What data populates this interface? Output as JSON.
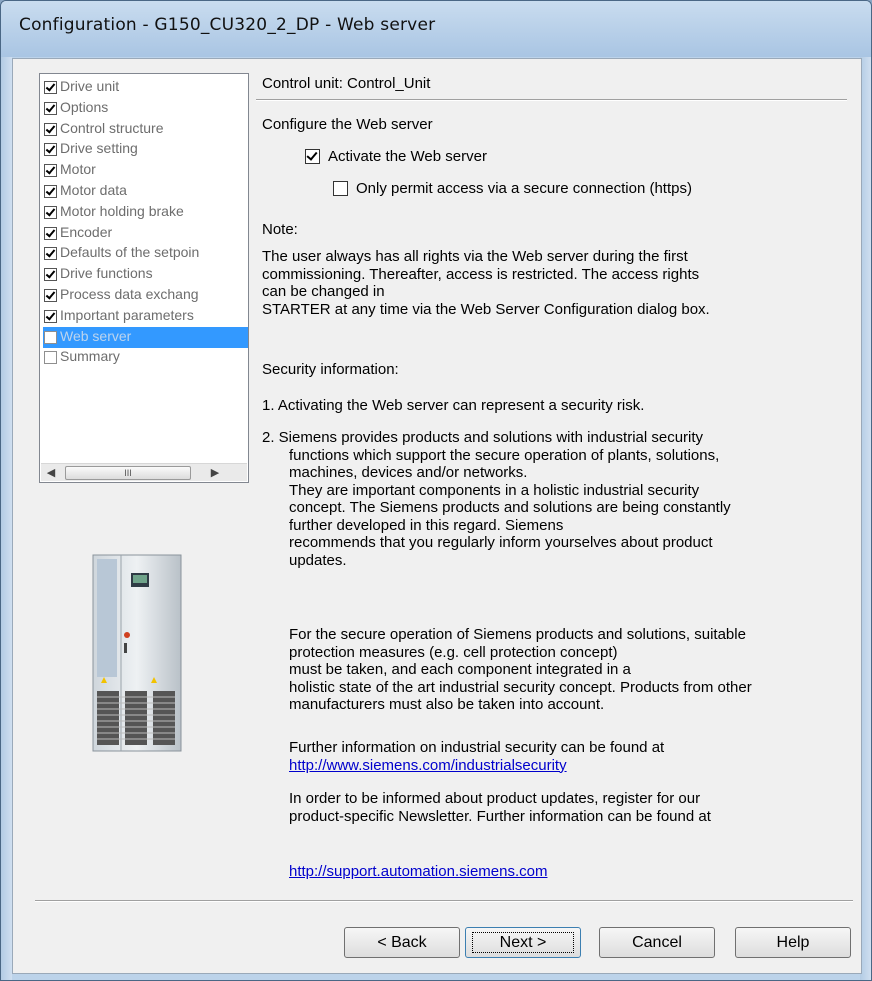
{
  "window": {
    "title": "Configuration - G150_CU320_2_DP - Web server"
  },
  "tree": {
    "items": [
      {
        "label": "Drive unit",
        "checked": true
      },
      {
        "label": "Options",
        "checked": true
      },
      {
        "label": "Control structure",
        "checked": true
      },
      {
        "label": "Drive setting",
        "checked": true
      },
      {
        "label": "Motor",
        "checked": true
      },
      {
        "label": "Motor data",
        "checked": true
      },
      {
        "label": "Motor holding brake",
        "checked": true
      },
      {
        "label": "Encoder",
        "checked": true
      },
      {
        "label": "Defaults of the setpoin",
        "checked": true
      },
      {
        "label": "Drive functions",
        "checked": true
      },
      {
        "label": "Process data exchang",
        "checked": true
      },
      {
        "label": "Important parameters",
        "checked": true
      },
      {
        "label": "Web server",
        "checked": false,
        "selected": true
      },
      {
        "label": "Summary",
        "checked": false
      }
    ],
    "scroll_thumb": "III"
  },
  "header": {
    "control_unit": "Control unit: Control_Unit"
  },
  "config": {
    "heading": "Configure the Web server",
    "activate_label": "Activate the Web server",
    "activate_checked": true,
    "https_label": "Only permit access via a secure connection (https)",
    "https_checked": false
  },
  "note": {
    "heading": "Note:",
    "line1": "The user always has all rights via the Web server during the first",
    "line2": "commissioning. Thereafter, access is restricted. The access rights",
    "line3": "can be changed in",
    "line4": "STARTER at any time via the Web Server Configuration dialog box."
  },
  "security": {
    "heading": "Security information:",
    "item1": "1. Activating the Web server can represent a security risk.",
    "item2_l1": "2. Siemens provides products and solutions with industrial security",
    "item2_l2": "functions which support the secure operation of plants, solutions,",
    "item2_l3": "machines, devices and/or networks.",
    "item2_l4": "They are important components in a holistic industrial security",
    "item2_l5": "concept. The Siemens products and solutions are being constantly",
    "item2_l6": "further developed in this regard. Siemens",
    "item2_l7": "recommends that you regularly inform yourselves about product",
    "item2_l8": "updates.",
    "p2_l1": "For the secure operation of Siemens products and solutions, suitable",
    "p2_l2": "protection measures (e.g. cell protection concept)",
    "p2_l3": "must be taken, and each component integrated in a",
    "p2_l4": "holistic state of the art industrial security concept. Products from other",
    "p2_l5": "manufacturers must also be taken into account.",
    "p3_l1": "Further information on industrial security can be found at",
    "p3_link": "http://www.siemens.com/industrialsecurity",
    "p4_l1": "In order to be informed about product updates, register for our",
    "p4_l2": "product-specific Newsletter. Further information can be found at",
    "p4_link": "http://support.automation.siemens.com"
  },
  "buttons": {
    "back": "< Back",
    "next": "Next >",
    "cancel": "Cancel",
    "help": "Help"
  }
}
